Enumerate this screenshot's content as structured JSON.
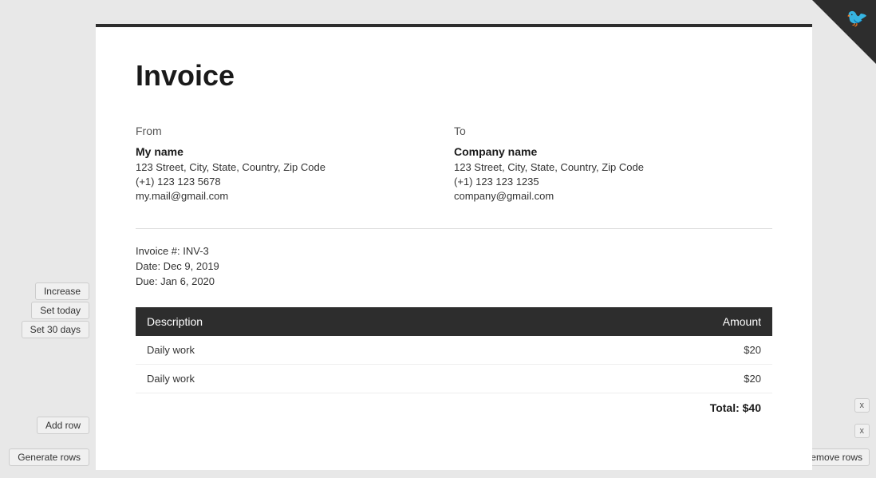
{
  "corner": {
    "icon": "🐦"
  },
  "sidebar_left": {
    "increase_label": "Increase",
    "set_today_label": "Set today",
    "set_30_days_label": "Set 30 days",
    "add_row_label": "Add row",
    "generate_rows_label": "Generate rows"
  },
  "sidebar_right": {
    "remove_x_label": "x",
    "remove_rows_label": "Remove rows"
  },
  "invoice": {
    "title": "Invoice",
    "from": {
      "label": "From",
      "name": "My name",
      "address": "123 Street, City, State, Country, Zip Code",
      "phone": "(+1) 123 123 5678",
      "email": "my.mail@gmail.com"
    },
    "to": {
      "label": "To",
      "name": "Company name",
      "address": "123 Street, City, State, Country, Zip Code",
      "phone": "(+1) 123 123 1235",
      "email": "company@gmail.com"
    },
    "invoice_number_label": "Invoice #: INV-3",
    "date_label": "Date: Dec 9, 2019",
    "due_label": "Due: Jan 6, 2020",
    "table": {
      "columns": [
        {
          "key": "description",
          "label": "Description"
        },
        {
          "key": "amount",
          "label": "Amount"
        }
      ],
      "rows": [
        {
          "description": "Daily work",
          "amount": "$20"
        },
        {
          "description": "Daily work",
          "amount": "$20"
        }
      ],
      "total_label": "Total: $40"
    }
  }
}
